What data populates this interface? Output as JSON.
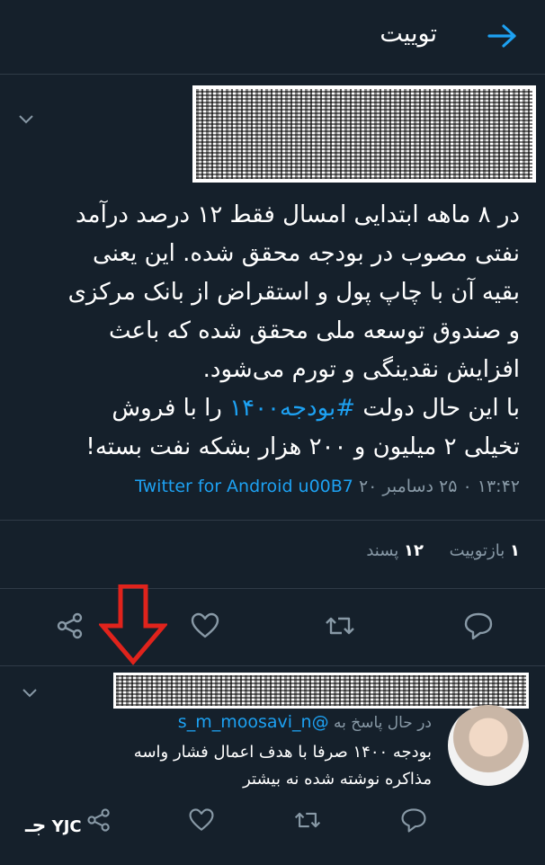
{
  "header": {
    "title": "توییت"
  },
  "tweet": {
    "lines": [
      "در ۸ ماهه ابتدایی امسال فقط ۱۲ درصد درآمد",
      "نفتی مصوب در بودجه محقق شده. این یعنی",
      "بقیه آن با چاپ پول و استقراض از بانک مرکزی",
      "و صندوق توسعه ملی محقق شده که باعث",
      "افزایش نقدینگی و تورم می‌شود."
    ],
    "line6_pre": "با این حال دولت",
    "hashtag": "#بودجه۱۴۰۰",
    "line6_post": "را با فروش",
    "line7": "تخیلی ۲ میلیون و ۲۰۰ هزار بشکه نفت بسته!",
    "timestamp": "۱۳:۴۲ ۰ ۲۵ دسامبر ۲۰",
    "client": "Twitter for Android u00B7"
  },
  "stats": {
    "retweet_count": "۱",
    "retweet_label": "بازتوییت",
    "like_count": "۱۲",
    "like_label": "پسند"
  },
  "reply": {
    "replying_label": "در حال پاسخ به",
    "handle": "@s_m_moosavi_n",
    "text": "بودجه ۱۴۰۰ صرفا با هدف اعمال فشار واسه مذاکره نوشته شده نه بیشتر"
  },
  "watermark": {
    "text": "YJC"
  },
  "colors": {
    "background": "#15202b",
    "accent": "#1da1f2",
    "muted": "#8899a6",
    "divider": "#2f3b47",
    "annotation_arrow": "#e0231c"
  },
  "icons": [
    "back-arrow-icon",
    "chevron-down-icon",
    "share-icon",
    "like-icon",
    "retweet-icon",
    "reply-icon"
  ]
}
